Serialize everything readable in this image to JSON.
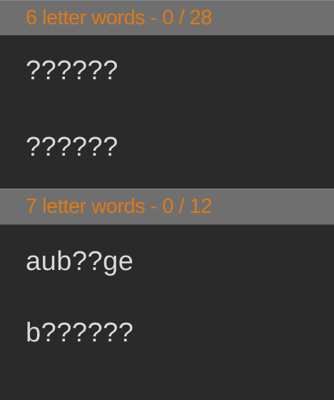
{
  "sections": [
    {
      "header": "6 letter words - 0 / 28",
      "words": [
        "??????",
        "??????"
      ]
    },
    {
      "header": "7 letter words - 0 / 12",
      "words": [
        "aub??ge",
        "b??????"
      ]
    }
  ],
  "colors": {
    "background": "#2a2a2a",
    "header_background": "#6f6f6f",
    "header_text": "#e07a16",
    "word_text": "#d9d9d9"
  }
}
